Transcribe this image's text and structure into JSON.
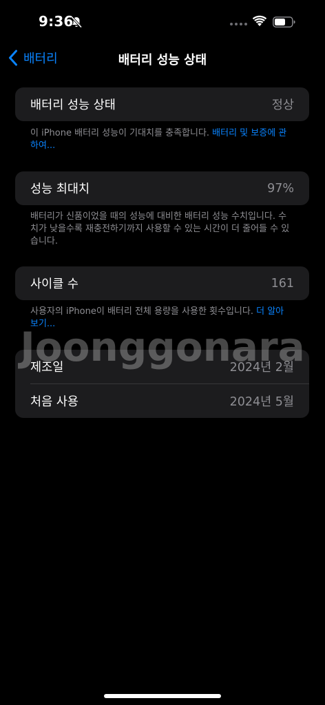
{
  "status_bar": {
    "time": "9:36",
    "mute_icon": "bell-slash-icon",
    "wifi_icon": "wifi-icon",
    "battery_icon": "battery-icon"
  },
  "nav": {
    "back_label": "배터리",
    "title": "배터리 성능 상태"
  },
  "battery_health": {
    "label": "배터리 성능 상태",
    "value": "정상",
    "footnote_text": "이 iPhone 배터리 성능이 기대치를 충족합니다. ",
    "footnote_link": "배터리 및 보증에 관하여..."
  },
  "max_capacity": {
    "label": "성능 최대치",
    "value": "97%",
    "footnote_text": "배터리가 신품이었을 때의 성능에 대비한 배터리 성능 수치입니다. 수치가 낮을수록 재충전하기까지 사용할 수 있는 시간이 더 줄어들 수 있습니다."
  },
  "cycle_count": {
    "label": "사이클 수",
    "value": "161",
    "footnote_text": "사용자의 iPhone이 배터리 전체 용량을 사용한 횟수입니다. ",
    "footnote_link": "더 알아보기..."
  },
  "dates": {
    "manufactured_label": "제조일",
    "manufactured_value": "2024년 2월",
    "first_use_label": "처음 사용",
    "first_use_value": "2024년 5월"
  },
  "watermark": "Joonggonara",
  "colors": {
    "background": "#000000",
    "cell": "#1c1c1e",
    "accent": "#0a84ff",
    "secondary_text": "#8e8e93"
  }
}
